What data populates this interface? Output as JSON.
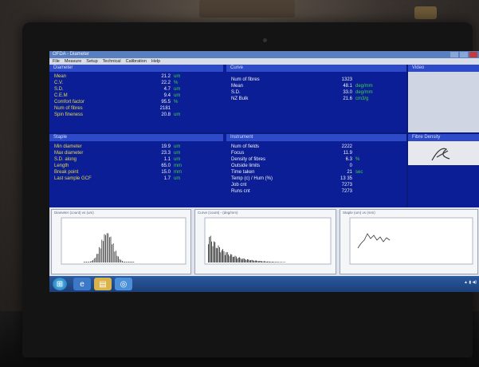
{
  "window": {
    "title": "OFDA - Diameter",
    "menu": [
      "File",
      "Measure",
      "Setup",
      "Technical",
      "Calibration",
      "Help"
    ]
  },
  "diameter": {
    "header": "Diameter",
    "rows": [
      {
        "label": "Mean",
        "value": "21.2",
        "unit": "um",
        "color": "#e7d84a"
      },
      {
        "label": "C.V.",
        "value": "22.2",
        "unit": "%",
        "color": "#e7d84a"
      },
      {
        "label": "S.D.",
        "value": "4.7",
        "unit": "um",
        "color": "#e7d84a"
      },
      {
        "label": "C.E.M",
        "value": "9.4",
        "unit": "um",
        "color": "#e7d84a"
      },
      {
        "label": "Comfort factor",
        "value": "95.5",
        "unit": "%",
        "color": "#e7d84a"
      },
      {
        "label": "Num of fibres",
        "value": "2181",
        "unit": "",
        "color": "#e7d84a"
      },
      {
        "label": "Spin fineness",
        "value": "20.8",
        "unit": "um",
        "color": "#e7d84a"
      }
    ]
  },
  "curve": {
    "header": "Curve",
    "rows": [
      {
        "label": "Num of fibres",
        "value": "1323",
        "unit": ""
      },
      {
        "label": "Mean",
        "value": "48.1",
        "unit": "deg/mm"
      },
      {
        "label": "S.D.",
        "value": "33.0",
        "unit": "deg/mm"
      },
      {
        "label": "NZ Bulk",
        "value": "21.6",
        "unit": "cm3/g"
      }
    ]
  },
  "video": {
    "header": "Video"
  },
  "staple": {
    "header": "Staple",
    "rows": [
      {
        "label": "Min diameter",
        "value": "19.9",
        "unit": "um"
      },
      {
        "label": "Max diameter",
        "value": "23.3",
        "unit": "um"
      },
      {
        "label": "S.D. along",
        "value": "1.1",
        "unit": "um"
      },
      {
        "label": "Length",
        "value": "65.0",
        "unit": "mm"
      },
      {
        "label": "Break point",
        "value": "15.0",
        "unit": "mm"
      },
      {
        "label": "Last sample GCF",
        "value": "1.7",
        "unit": "um"
      }
    ]
  },
  "instrument": {
    "header": "Instrument",
    "rows": [
      {
        "label": "Num of fields",
        "value": "2222",
        "unit": ""
      },
      {
        "label": "Focus",
        "value": "11.9",
        "unit": ""
      },
      {
        "label": "Density of fibres",
        "value": "6.3",
        "unit": "%"
      },
      {
        "label": "Outside limits",
        "value": "0",
        "unit": ""
      },
      {
        "label": "Time taken",
        "value": "21",
        "unit": "sec"
      },
      {
        "label": "Temp (c) / Hum (%)",
        "value": "13   35",
        "unit": ""
      },
      {
        "label": "Job cnt",
        "value": "7273",
        "unit": ""
      },
      {
        "label": "Runs cnt",
        "value": "7273",
        "unit": ""
      }
    ]
  },
  "fibre_density": {
    "header": "Fibre Density"
  },
  "charts": [
    {
      "title": "Diameter (count) vs (um)"
    },
    {
      "title": "Curve (count) - (deg/mm)"
    },
    {
      "title": "Staple (um) vs (mm)"
    }
  ],
  "colors": {
    "panel": "#0b1e96",
    "label_yellow": "#e7d84a",
    "unit_green": "#3bd24a",
    "header_blue": "#2d4ac8",
    "taskbar": "#2a5a9e"
  },
  "taskbar": {
    "icons": [
      "start-orb-icon",
      "internet-explorer-icon",
      "file-explorer-icon",
      "app-icon"
    ]
  }
}
